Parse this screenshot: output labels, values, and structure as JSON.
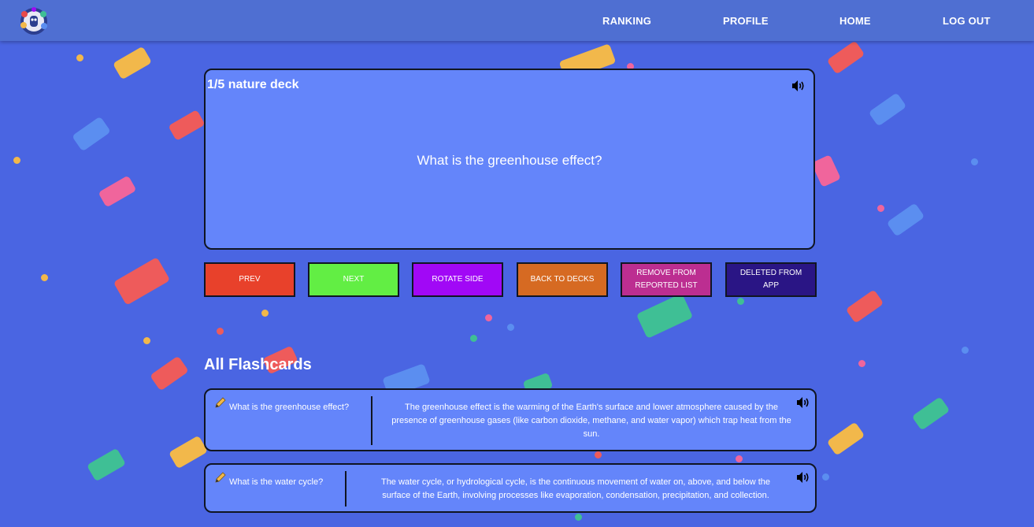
{
  "nav": {
    "links": [
      "RANKING",
      "PROFILE",
      "HOME",
      "LOG OUT"
    ]
  },
  "main_card": {
    "title": "1/5 nature deck",
    "question": "What is the greenhouse effect?"
  },
  "buttons": {
    "prev": "PREV",
    "next": "NEXT",
    "rotate": "ROTATE SIDE",
    "back": "BACK TO DECKS",
    "remove": "REMOVE FROM REPORTED LIST",
    "deleted": "DELETED FROM APP"
  },
  "button_colors": {
    "prev": "#e8412b",
    "next": "#62ee44",
    "rotate": "#a108f6",
    "back": "#d66a22",
    "remove": "#bc2e91",
    "deleted": "#2a1585"
  },
  "section_title": "All Flashcards",
  "flashcards": [
    {
      "question": "What is the greenhouse effect?",
      "answer": "The greenhouse effect is the warming of the Earth's surface and lower atmosphere caused by the presence of greenhouse gases (like carbon dioxide, methane, and water vapor) which trap heat from the sun."
    },
    {
      "question": "What is the water cycle?",
      "answer": "The water cycle, or hydrological cycle, is the continuous movement of water on, above, and below the surface of the Earth, involving processes like evaporation, condensation, precipitation, and collection."
    }
  ],
  "icons": {
    "logo": "app-logo",
    "speaker": "speaker-icon",
    "pencil": "pencil-icon"
  },
  "colors": {
    "background": "#4a65e2",
    "navbar": "#4f6fd2",
    "card": "#6485fa"
  }
}
